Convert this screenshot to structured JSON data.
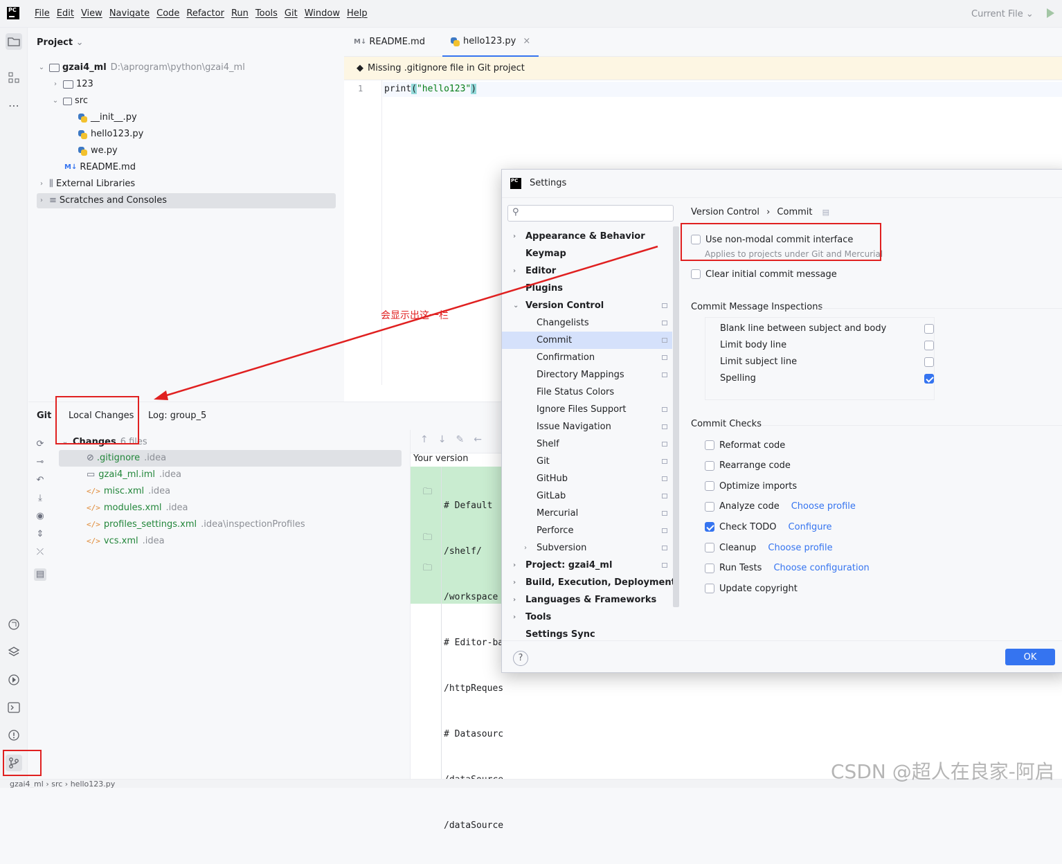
{
  "menubar": {
    "logo": "PC",
    "menus": [
      "File",
      "Edit",
      "View",
      "Navigate",
      "Code",
      "Refactor",
      "Run",
      "Tools",
      "Git",
      "Window",
      "Help"
    ],
    "current_file": "Current File"
  },
  "project": {
    "title": "Project",
    "tree": {
      "root_name": "gzai4_ml",
      "root_path": "D:\\aprogram\\python\\gzai4_ml",
      "folder_123": "123",
      "folder_src": "src",
      "file_init": "__init__.py",
      "file_hello": "hello123.py",
      "file_we": "we.py",
      "file_readme": "README.md",
      "external_libraries": "External Libraries",
      "scratches": "Scratches and Consoles"
    }
  },
  "editor": {
    "tabs": [
      "README.md",
      "hello123.py"
    ],
    "banner": "Missing .gitignore file in Git project",
    "line_number": "1",
    "code_fn": "print",
    "code_paren_open": "(",
    "code_string": "\"hello123\"",
    "code_paren_close": ")"
  },
  "git_panel": {
    "tabs": [
      "Git",
      "Local Changes",
      "Log: group_5"
    ],
    "changes_label": "Changes",
    "changes_count": "6 files",
    "files": [
      {
        "name": ".gitignore",
        "dir": ".idea"
      },
      {
        "name": "gzai4_ml.iml",
        "dir": ".idea"
      },
      {
        "name": "misc.xml",
        "dir": ".idea"
      },
      {
        "name": "modules.xml",
        "dir": ".idea"
      },
      {
        "name": "profiles_settings.xml",
        "dir": ".idea\\inspectionProfiles"
      },
      {
        "name": "vcs.xml",
        "dir": ".idea"
      }
    ],
    "diff_header": "Your version",
    "diff_lines": [
      "# Default",
      "/shelf/",
      "/workspace",
      "# Editor-ba",
      "/httpReques",
      "# Datasourc",
      "/dataSource",
      "/dataSource"
    ]
  },
  "settings": {
    "title": "Settings",
    "breadcrumb": [
      "Version Control",
      "Commit"
    ],
    "nav": [
      {
        "label": "Appearance & Behavior"
      },
      {
        "label": "Keymap"
      },
      {
        "label": "Editor"
      },
      {
        "label": "Plugins"
      },
      {
        "label": "Version Control"
      },
      {
        "label": "Changelists"
      },
      {
        "label": "Commit"
      },
      {
        "label": "Confirmation"
      },
      {
        "label": "Directory Mappings"
      },
      {
        "label": "File Status Colors"
      },
      {
        "label": "Ignore Files Support"
      },
      {
        "label": "Issue Navigation"
      },
      {
        "label": "Shelf"
      },
      {
        "label": "Git"
      },
      {
        "label": "GitHub"
      },
      {
        "label": "GitLab"
      },
      {
        "label": "Mercurial"
      },
      {
        "label": "Perforce"
      },
      {
        "label": "Subversion"
      },
      {
        "label": "Project: gzai4_ml"
      },
      {
        "label": "Build, Execution, Deployment"
      },
      {
        "label": "Languages & Frameworks"
      },
      {
        "label": "Tools"
      },
      {
        "label": "Settings Sync"
      }
    ],
    "non_modal": {
      "label": "Use non-modal commit interface",
      "hint": "Applies to projects under Git and Mercurial",
      "checked": false
    },
    "clear_initial": {
      "label": "Clear initial commit message",
      "checked": false
    },
    "inspections_title": "Commit Message Inspections",
    "inspections": [
      {
        "label": "Blank line between subject and body",
        "checked": false
      },
      {
        "label": "Limit body line",
        "checked": false
      },
      {
        "label": "Limit subject line",
        "checked": false
      },
      {
        "label": "Spelling",
        "checked": true
      }
    ],
    "checks_title": "Commit Checks",
    "checks": [
      {
        "label": "Reformat code",
        "link": "",
        "checked": false
      },
      {
        "label": "Rearrange code",
        "link": "",
        "checked": false
      },
      {
        "label": "Optimize imports",
        "link": "",
        "checked": false
      },
      {
        "label": "Analyze code",
        "link": "Choose profile",
        "checked": false
      },
      {
        "label": "Check TODO",
        "link": "Configure",
        "checked": true
      },
      {
        "label": "Cleanup",
        "link": "Choose profile",
        "checked": false
      },
      {
        "label": "Run Tests",
        "link": "Choose configuration",
        "checked": false
      },
      {
        "label": "Update copyright",
        "link": "",
        "checked": false
      }
    ],
    "ok_label": "OK",
    "help_label": "?"
  },
  "annotation": "会显示出这一栏",
  "statusbar": {
    "crumbs": [
      "gzai4_ml",
      "src",
      "hello123.py"
    ]
  },
  "watermark": "CSDN @超人在良家-阿启",
  "colors": {
    "accent": "#3574f0",
    "annotation_red": "#e02020",
    "diff_added": "#c9ecd0"
  }
}
